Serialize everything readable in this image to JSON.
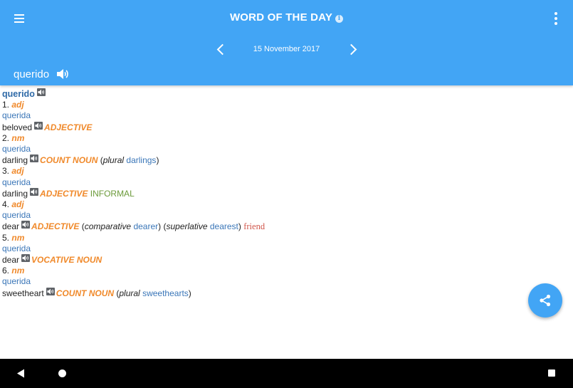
{
  "header": {
    "title": "WORD OF THE DAY",
    "info_glyph": "i",
    "date": "15 November 2017",
    "word": "querido",
    "icons": [
      "menu-icon",
      "info-icon",
      "overflow-menu-icon",
      "chevron-left-icon",
      "chevron-right-icon",
      "speaker-icon"
    ]
  },
  "entry": {
    "headword": "querido",
    "senses": [
      {
        "num": "1.",
        "pos": "adj",
        "source": "querida",
        "translation": "beloved",
        "type": "ADJECTIVE"
      },
      {
        "num": "2.",
        "pos": "nm",
        "source": "querida",
        "translation": "darling",
        "type": "COUNT NOUN",
        "infl_open": "(",
        "infl_label": "plural",
        "infl_word": "darlings",
        "infl_close": ")"
      },
      {
        "num": "3.",
        "pos": "adj",
        "source": "querida",
        "translation": "darling",
        "type": "ADJECTIVE",
        "register": "INFORMAL"
      },
      {
        "num": "4.",
        "pos": "adj",
        "source": "querida",
        "translation": "dear",
        "type": "ADJECTIVE",
        "comp_open": "(",
        "comp_label": "comparative",
        "comp_word": "dearer",
        "comp_close": ")",
        "sup_open": "(",
        "sup_label": "superlative",
        "sup_word": "dearest",
        "sup_close": ")",
        "extra": "friend"
      },
      {
        "num": "5.",
        "pos": "nm",
        "source": "querida",
        "translation": "dear",
        "type": "VOCATIVE NOUN"
      },
      {
        "num": "6.",
        "pos": "nm",
        "source": "querida",
        "translation": "sweetheart",
        "type": "COUNT NOUN",
        "infl_open": "(",
        "infl_label": "plural",
        "infl_word": "sweethearts",
        "infl_close": ")"
      }
    ]
  },
  "colors": {
    "appbar": "#42a5f5",
    "headword": "#2f6aa7",
    "link": "#3a76b8",
    "pos": "#f0892a",
    "register": "#6b9a3a",
    "extra": "#d0554a"
  },
  "fab": {
    "icon": "share-icon"
  },
  "navbar": {
    "icons": [
      "back-icon",
      "home-icon",
      "recents-icon"
    ]
  }
}
